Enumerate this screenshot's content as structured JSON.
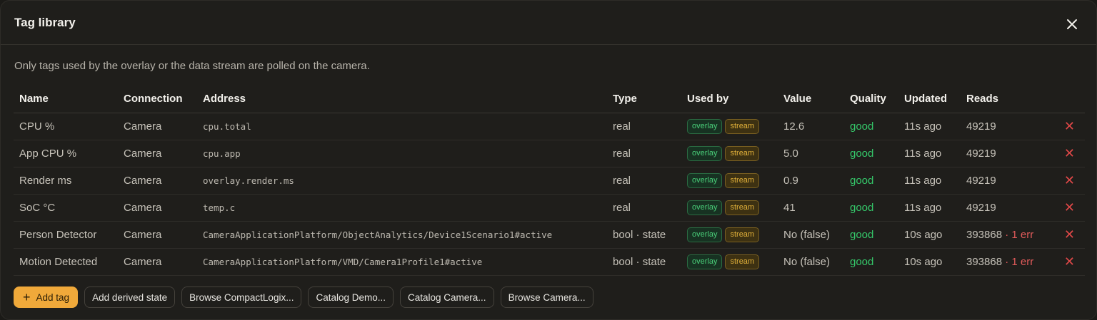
{
  "dialog": {
    "title": "Tag library",
    "description": "Only tags used by the overlay or the data stream are polled on the camera."
  },
  "table": {
    "headers": [
      "Name",
      "Connection",
      "Address",
      "Type",
      "Used by",
      "Value",
      "Quality",
      "Updated",
      "Reads"
    ],
    "rows": [
      {
        "name": "CPU %",
        "connection": "Camera",
        "address": "cpu.total",
        "type": "real",
        "tag1": "overlay",
        "tag2": "stream",
        "value": "12.6",
        "quality": "good",
        "updated": "11s ago",
        "reads": "49219",
        "errors": ""
      },
      {
        "name": "App CPU %",
        "connection": "Camera",
        "address": "cpu.app",
        "type": "real",
        "tag1": "overlay",
        "tag2": "stream",
        "value": "5.0",
        "quality": "good",
        "updated": "11s ago",
        "reads": "49219",
        "errors": ""
      },
      {
        "name": "Render ms",
        "connection": "Camera",
        "address": "overlay.render.ms",
        "type": "real",
        "tag1": "overlay",
        "tag2": "stream",
        "value": "0.9",
        "quality": "good",
        "updated": "11s ago",
        "reads": "49219",
        "errors": ""
      },
      {
        "name": "SoC °C",
        "connection": "Camera",
        "address": "temp.c",
        "type": "real",
        "tag1": "overlay",
        "tag2": "stream",
        "value": "41",
        "quality": "good",
        "updated": "11s ago",
        "reads": "49219",
        "errors": ""
      },
      {
        "name": "Person Detector",
        "connection": "Camera",
        "address": "CameraApplicationPlatform/ObjectAnalytics/Device1Scenario1#active",
        "type": "bool · state",
        "tag1": "overlay",
        "tag2": "stream",
        "value": "No (false)",
        "quality": "good",
        "updated": "10s ago",
        "reads": "393868",
        "errors": " · 1 err"
      },
      {
        "name": "Motion Detected",
        "connection": "Camera",
        "address": "CameraApplicationPlatform/VMD/Camera1Profile1#active",
        "type": "bool · state",
        "tag1": "overlay",
        "tag2": "stream",
        "value": "No (false)",
        "quality": "good",
        "updated": "10s ago",
        "reads": "393868",
        "errors": " · 1 err"
      }
    ],
    "delete_glyph": "✕"
  },
  "actions": {
    "add_tag": "Add tag",
    "add_derived": "Add derived state",
    "browse_compactlogix": "Browse CompactLogix...",
    "catalog_demo": "Catalog Demo...",
    "catalog_camera": "Catalog Camera...",
    "browse_camera": "Browse Camera..."
  },
  "colors": {
    "accent": "#f0a93a",
    "good": "#35c86a",
    "error": "#e05a5a"
  },
  "icons": {
    "close": "close-icon",
    "add": "plus-icon",
    "delete": "delete-icon"
  }
}
